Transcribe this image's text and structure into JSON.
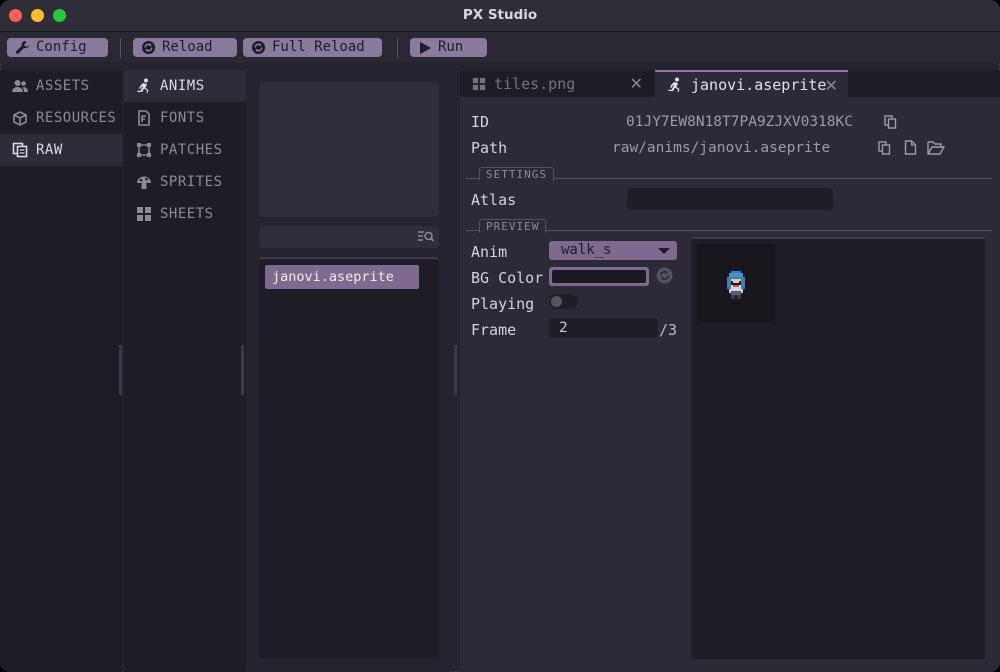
{
  "window": {
    "title": "PX Studio"
  },
  "toolbar": {
    "config_label": "Config",
    "reload_label": "Reload",
    "full_reload_label": "Full Reload",
    "run_label": "Run"
  },
  "nav_primary": {
    "items": [
      {
        "label": "ASSETS",
        "icon": "users-icon"
      },
      {
        "label": "RESOURCES",
        "icon": "cube-icon"
      },
      {
        "label": "RAW",
        "icon": "copy-icon",
        "selected": true
      }
    ]
  },
  "nav_secondary": {
    "items": [
      {
        "label": "ANIMS",
        "icon": "running-person-icon",
        "selected": true
      },
      {
        "label": "FONTS",
        "icon": "font-file-icon"
      },
      {
        "label": "PATCHES",
        "icon": "vector-square-icon"
      },
      {
        "label": "SPRITES",
        "icon": "mushroom-icon"
      },
      {
        "label": "SHEETS",
        "icon": "grid-icon"
      }
    ]
  },
  "file_list": {
    "items": [
      "janovi.aseprite"
    ],
    "selected": "janovi.aseprite"
  },
  "tabs": [
    {
      "label": "tiles.png",
      "icon": "grid-icon",
      "active": false
    },
    {
      "label": "janovi.aseprite",
      "icon": "running-person-icon",
      "active": true
    }
  ],
  "details": {
    "id_label": "ID",
    "id_value": "01JY7EW8N18T7PA9ZJXV0318KC",
    "path_label": "Path",
    "path_value": "raw/anims/janovi.aseprite",
    "settings_section": "SETTINGS",
    "atlas_label": "Atlas",
    "atlas_value": "",
    "preview_section": "PREVIEW",
    "anim_label": "Anim",
    "anim_value": "walk_s",
    "bg_color_label": "BG Color",
    "bg_color_value": "#1a1a22",
    "playing_label": "Playing",
    "playing": false,
    "frame_label": "Frame",
    "frame_value": "2",
    "frame_total": "/3"
  },
  "colors": {
    "accent": "#8a7a9c",
    "selection": "#7d6a8e",
    "panel": "#1e1d26",
    "background": "#25232f"
  }
}
